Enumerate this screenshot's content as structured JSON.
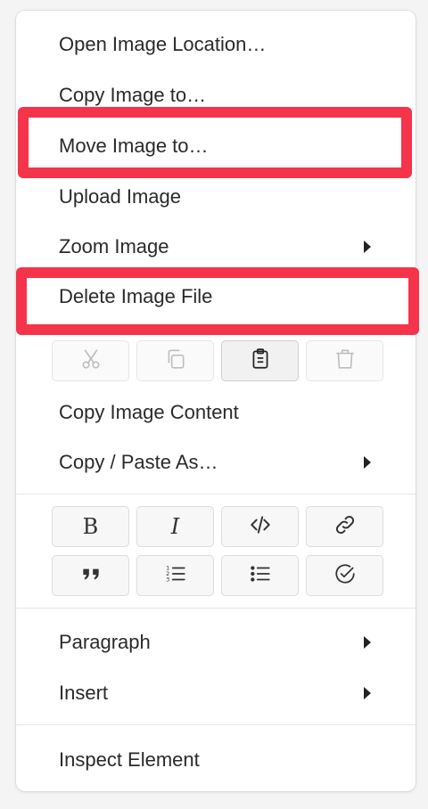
{
  "menu": {
    "items_top": [
      {
        "label": "Open Image Location…",
        "submenu": false
      },
      {
        "label": "Copy Image to…",
        "submenu": false
      },
      {
        "label": "Move Image to…",
        "submenu": false,
        "highlighted": true
      },
      {
        "label": "Upload Image",
        "submenu": false
      },
      {
        "label": "Zoom Image",
        "submenu": true
      },
      {
        "label": "Delete Image File",
        "submenu": false,
        "highlighted": true
      }
    ],
    "edit_buttons": [
      {
        "name": "cut",
        "icon": "scissors-icon",
        "state": "disabled"
      },
      {
        "name": "copy",
        "icon": "copy-icon",
        "state": "disabled"
      },
      {
        "name": "paste",
        "icon": "clipboard-icon",
        "state": "active"
      },
      {
        "name": "delete",
        "icon": "trash-icon",
        "state": "disabled"
      }
    ],
    "items_middle": [
      {
        "label": "Copy Image Content",
        "submenu": false
      },
      {
        "label": "Copy / Paste As…",
        "submenu": true
      }
    ],
    "format_buttons_row1": [
      {
        "name": "bold",
        "icon": "bold-icon",
        "glyph": "B"
      },
      {
        "name": "italic",
        "icon": "italic-icon",
        "glyph": "I"
      },
      {
        "name": "code",
        "icon": "code-icon"
      },
      {
        "name": "link",
        "icon": "link-icon"
      }
    ],
    "format_buttons_row2": [
      {
        "name": "quote",
        "icon": "quote-icon"
      },
      {
        "name": "ordered-list",
        "icon": "ordered-list-icon"
      },
      {
        "name": "unordered-list",
        "icon": "unordered-list-icon"
      },
      {
        "name": "task-list",
        "icon": "task-list-icon"
      }
    ],
    "items_bottom": [
      {
        "label": "Paragraph",
        "submenu": true
      },
      {
        "label": "Insert",
        "submenu": true
      }
    ],
    "inspect": {
      "label": "Inspect Element"
    }
  },
  "colors": {
    "highlight": "#f5334a",
    "text": "#2a2a2a",
    "background": "#ffffff"
  }
}
